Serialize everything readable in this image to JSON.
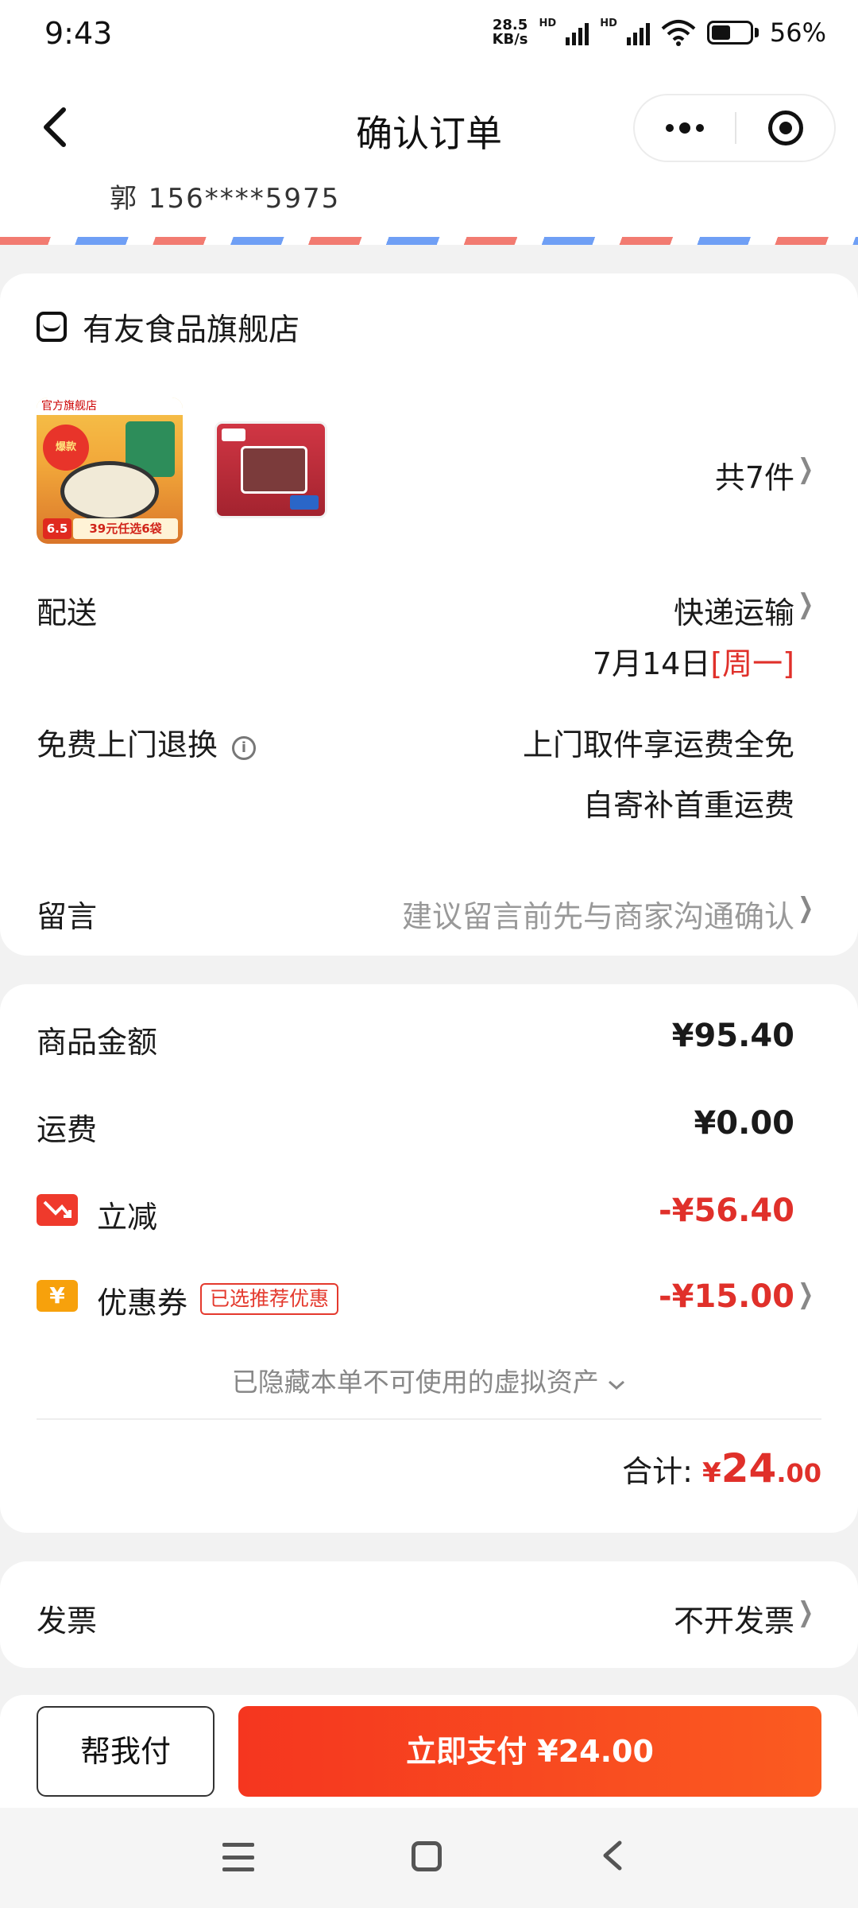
{
  "status_bar": {
    "time": "9:43",
    "net_speed_value": "28.5",
    "net_speed_unit": "KB/s",
    "network1": "HD",
    "network2": "HD",
    "battery": "56%",
    "battery_level": 0.56
  },
  "nav": {
    "title": "确认订单"
  },
  "address": {
    "partial_text": "郭 156****5975"
  },
  "shop": {
    "name": "有友食品旗舰店",
    "product1_flag": "官方旗舰店",
    "product1_burst": "爆款",
    "product1_price": "6.5",
    "product1_promo": "39元任选6袋",
    "item_count": "共7件",
    "delivery_label": "配送",
    "delivery_method": "快递运输",
    "delivery_date": "7月14日",
    "delivery_weekday": "[周一]",
    "return_label": "免费上门退换",
    "return_line1": "上门取件享运费全免",
    "return_line2": "自寄补首重运费",
    "message_label": "留言",
    "message_placeholder": "建议留言前先与商家沟通确认"
  },
  "price": {
    "goods_label": "商品金额",
    "goods_value": "¥95.40",
    "shipping_label": "运费",
    "shipping_value": "¥0.00",
    "discount_label": "立减",
    "discount_value": "-¥56.40",
    "coupon_icon": "¥",
    "coupon_label": "优惠券",
    "coupon_tag": "已选推荐优惠",
    "coupon_value": "-¥15.00",
    "hidden_assets": "已隐藏本单不可使用的虚拟资产",
    "total_label": "合计:",
    "total_currency": "¥",
    "total_int": "24",
    "total_dec": ".00"
  },
  "invoice": {
    "label": "发票",
    "value": "不开发票"
  },
  "actions": {
    "help_pay": "帮我付",
    "pay_now": "立即支付 ¥24.00"
  },
  "colors": {
    "accent_red": "#e0302a",
    "pay_gradient_start": "#f5361f",
    "pay_gradient_end": "#fb5b20",
    "coupon_orange": "#f7a10c"
  },
  "icons": [
    "back-arrow-icon",
    "more-icon",
    "mini-program-close-icon",
    "shop-icon",
    "info-icon",
    "decrease-icon",
    "coupon-yen-icon",
    "chevron-right-icon",
    "chevron-down-icon",
    "menu-icon",
    "home-icon",
    "back-nav-icon"
  ]
}
